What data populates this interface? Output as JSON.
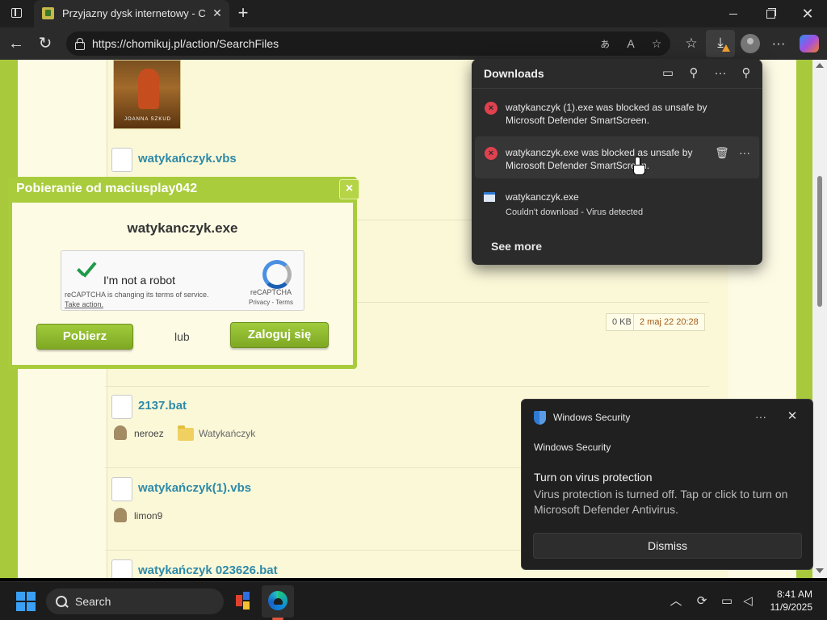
{
  "browser": {
    "tab_title": "Przyjazny dysk internetowy - Chomikuj.pl",
    "url": "https://chomikuj.pl/action/SearchFiles"
  },
  "icons": {
    "read_aloud": "read-aloud-icon",
    "translate": "translate-icon",
    "favorite": "star-icon",
    "favorites_bar": "favorites-icon",
    "downloads": "download-icon",
    "more": "ellipsis-icon"
  },
  "thumbnail": {
    "title": "JOANNA SZKUD"
  },
  "files": [
    {
      "name": "watykańczyk.vbs"
    },
    {
      "name": "2137.bat",
      "user": "neroez",
      "folder": "Watykańczyk"
    },
    {
      "name": "watykańczyk(1).vbs",
      "user": "limon9"
    },
    {
      "name": "watykańczyk 023626.bat"
    }
  ],
  "file_meta": {
    "size": "0 KB",
    "date": "2 maj 22 20:28"
  },
  "dialog": {
    "title": "Pobieranie od maciusplay042",
    "close": "×",
    "filename": "watykanczyk.exe",
    "recaptcha": {
      "label": "I'm not a robot",
      "brand": "reCAPTCHA",
      "links": "Privacy - Terms",
      "notice": "reCAPTCHA is changing its terms of service.",
      "action": "Take action."
    },
    "download_button": "Pobierz",
    "or_text": "lub",
    "login_button": "Zaloguj się"
  },
  "downloads_panel": {
    "title": "Downloads",
    "items": [
      {
        "text": "watykanczyk (1).exe was blocked as unsafe by Microsoft Defender SmartScreen.",
        "status": "blocked"
      },
      {
        "text": "watykanczyk.exe was blocked as unsafe by Microsoft Defender SmartScreen.",
        "status": "blocked"
      },
      {
        "text": "watykanczyk.exe",
        "detail": "Couldn't download - Virus detected",
        "status": "failed"
      }
    ],
    "see_more": "See more"
  },
  "toast": {
    "app": "Windows Security",
    "subtitle": "Windows Security",
    "heading": "Turn on virus protection",
    "body": "Virus protection is turned off. Tap or click to turn on Microsoft Defender Antivirus.",
    "dismiss": "Dismiss",
    "more": "···",
    "close": "✕"
  },
  "taskbar": {
    "search_label": "Search",
    "time": "8:41 AM",
    "date": "11/9/2025"
  },
  "colors": {
    "page_accent": "#a7c93b",
    "link": "#2e8aa8",
    "error": "#e0414f",
    "button_green": "#8fba2f"
  }
}
